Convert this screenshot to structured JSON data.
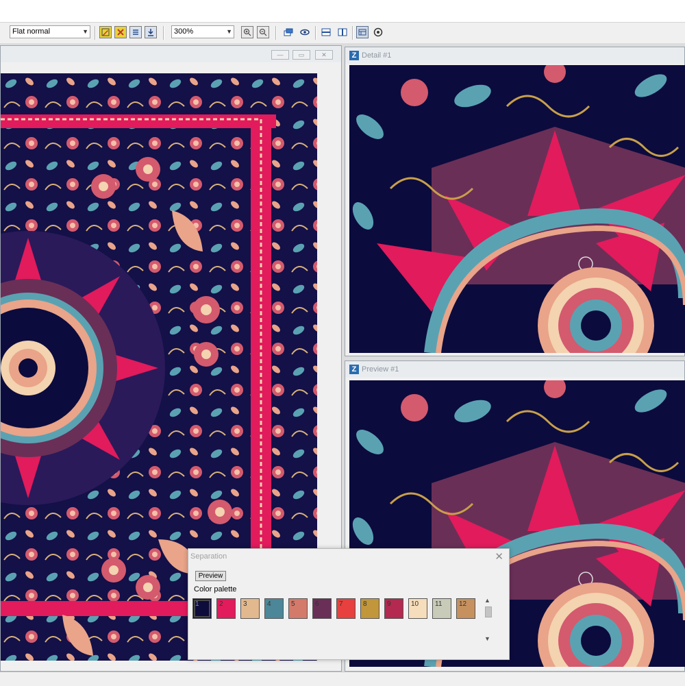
{
  "toolbar": {
    "render_mode": "Flat normal",
    "zoom": "300%",
    "icons": [
      "pencil-icon",
      "eraser-icon",
      "list-icon",
      "download-icon",
      "zoom-in-icon",
      "zoom-out-icon",
      "windows-icon",
      "eye-icon",
      "split-horizontal-icon",
      "split-vertical-icon",
      "grid-icon",
      "target-icon"
    ]
  },
  "windows": {
    "detail": {
      "title": "Detail #1"
    },
    "preview": {
      "title": "Preview #1"
    }
  },
  "separation": {
    "title": "Separation",
    "preview_button": "Preview",
    "color_palette_label": "Color palette",
    "swatches": [
      {
        "label": "1",
        "color": "#0d0c3a"
      },
      {
        "label": "2",
        "color": "#e11b5c"
      },
      {
        "label": "3",
        "color": "#e2b98e"
      },
      {
        "label": "4",
        "color": "#4b8798"
      },
      {
        "label": "5",
        "color": "#d47a6a"
      },
      {
        "label": "6",
        "color": "#6a2f57"
      },
      {
        "label": "7",
        "color": "#e7403e"
      },
      {
        "label": "8",
        "color": "#c2963a"
      },
      {
        "label": "9",
        "color": "#b3294f"
      },
      {
        "label": "10",
        "color": "#f6ddbb"
      },
      {
        "label": "11",
        "color": "#c7cbb8"
      },
      {
        "label": "12",
        "color": "#c6915f"
      }
    ]
  },
  "colors": {
    "navy": "#0c0b3d",
    "magenta": "#e11b5c",
    "peach": "#e9a489",
    "teal": "#5aa2b2",
    "plum": "#6a2f57",
    "gold": "#c8a04a",
    "cream": "#f3d3b0"
  }
}
